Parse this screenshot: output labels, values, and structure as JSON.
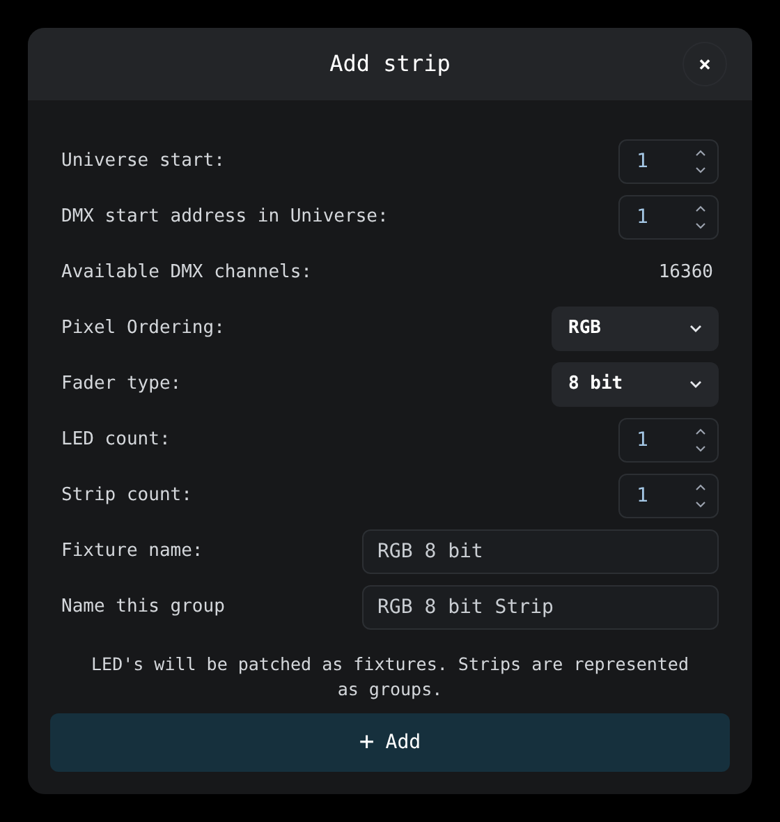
{
  "dialog": {
    "title": "Add strip",
    "close": "×"
  },
  "rows": [
    {
      "kind": "number",
      "label": "Universe start:",
      "value": "1"
    },
    {
      "kind": "number",
      "label": "DMX start address in Universe:",
      "value": "1"
    },
    {
      "kind": "readout",
      "label": "Available DMX channels:",
      "value": "16360"
    },
    {
      "kind": "select",
      "label": "Pixel Ordering:",
      "value": "RGB"
    },
    {
      "kind": "select",
      "label": "Fader type:",
      "value": "8 bit"
    },
    {
      "kind": "number",
      "label": "LED count:",
      "value": "1"
    },
    {
      "kind": "number",
      "label": "Strip count:",
      "value": "1"
    },
    {
      "kind": "text",
      "label": "Fixture name:",
      "value": "RGB 8 bit"
    },
    {
      "kind": "text",
      "label": "Name this group",
      "value": "RGB 8 bit Strip"
    }
  ],
  "note": "LED's will be patched as fixtures. Strips are represented as groups.",
  "add_button": {
    "icon": "+",
    "label": "Add"
  }
}
